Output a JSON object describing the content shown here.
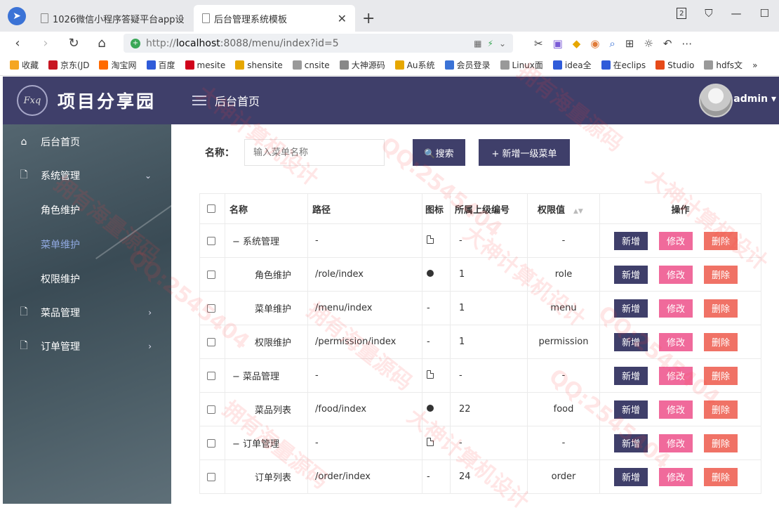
{
  "browser": {
    "tabs": [
      {
        "title": "1026微信小程序答疑平台app设",
        "active": false
      },
      {
        "title": "后台管理系统模板",
        "active": true
      }
    ],
    "tab_count": "2",
    "url": {
      "proto": "http://",
      "host": "localhost",
      "path": ":8088/menu/index?id=5"
    },
    "bookmarks": [
      {
        "label": "收藏",
        "color": "#f5a623"
      },
      {
        "label": "京东(JD",
        "color": "#c81623"
      },
      {
        "label": "淘宝网",
        "color": "#ff6a00"
      },
      {
        "label": "百度",
        "color": "#2f5bd9"
      },
      {
        "label": "mesite",
        "color": "#d0021b"
      },
      {
        "label": "shensite",
        "color": "#e6a700"
      },
      {
        "label": "cnsite",
        "color": "#999999"
      },
      {
        "label": "大神源码",
        "color": "#888888"
      },
      {
        "label": "Au系统",
        "color": "#e6a700"
      },
      {
        "label": "会员登录",
        "color": "#3b73d6"
      },
      {
        "label": "Linux面",
        "color": "#999999"
      },
      {
        "label": "idea全",
        "color": "#2f5bd9"
      },
      {
        "label": "在eclips",
        "color": "#2f5bd9"
      },
      {
        "label": "Studio",
        "color": "#e64a19"
      },
      {
        "label": "hdfs文",
        "color": "#999999"
      }
    ]
  },
  "header": {
    "logo_badge": "Fxq",
    "logo_text": "项目分享园",
    "title": "后台首页",
    "user": "admin ▾"
  },
  "sidebar": {
    "items": [
      {
        "label": "后台首页",
        "icon": "home-icon",
        "type": "top"
      },
      {
        "label": "系统管理",
        "icon": "file-icon",
        "type": "top",
        "arrow": "⌄"
      },
      {
        "label": "角色维护",
        "type": "sub"
      },
      {
        "label": "菜单维护",
        "type": "sub",
        "current": true
      },
      {
        "label": "权限维护",
        "type": "sub"
      },
      {
        "label": "菜品管理",
        "icon": "file-icon",
        "type": "top",
        "arrow": "›"
      },
      {
        "label": "订单管理",
        "icon": "file-icon",
        "type": "top",
        "arrow": "›"
      }
    ]
  },
  "search": {
    "label": "名称：",
    "placeholder": "输入菜单名称",
    "search_button": "🔍搜索",
    "add_button": "+ 新增一级菜单"
  },
  "table": {
    "headers": [
      "名称",
      "路径",
      "图标",
      "所属上级编号",
      "权限值",
      "操作"
    ],
    "actions": {
      "add": "新增",
      "edit": "修改",
      "delete": "删除"
    },
    "rows": [
      {
        "name": "− 系统管理",
        "level": "parent",
        "path": "-",
        "icon": "file",
        "parent": "-",
        "perm": "-"
      },
      {
        "name": "角色维护",
        "level": "child",
        "path": "/role/index",
        "icon": "dot",
        "parent": "1",
        "perm": "role"
      },
      {
        "name": "菜单维护",
        "level": "child",
        "path": "/menu/index",
        "icon": "none",
        "parent": "1",
        "perm": "menu"
      },
      {
        "name": "权限维护",
        "level": "child",
        "path": "/permission/index",
        "icon": "none",
        "parent": "1",
        "perm": "permission"
      },
      {
        "name": "− 菜品管理",
        "level": "parent",
        "path": "-",
        "icon": "file",
        "parent": "-",
        "perm": "-"
      },
      {
        "name": "菜品列表",
        "level": "child",
        "path": "/food/index",
        "icon": "dot",
        "parent": "22",
        "perm": "food"
      },
      {
        "name": "− 订单管理",
        "level": "parent",
        "path": "-",
        "icon": "file",
        "parent": "-",
        "perm": "-"
      },
      {
        "name": "订单列表",
        "level": "child",
        "path": "/order/index",
        "icon": "none",
        "parent": "24",
        "perm": "order"
      }
    ]
  },
  "watermark": {
    "lines": [
      "大神计算机设计",
      "QQ:2545404",
      "拥有海量源码"
    ]
  },
  "colors": {
    "header_bg": "#3f3f6a",
    "edit_btn": "#f06a9b",
    "delete_btn": "#f07266",
    "current_menu": "#8fa8e0"
  }
}
